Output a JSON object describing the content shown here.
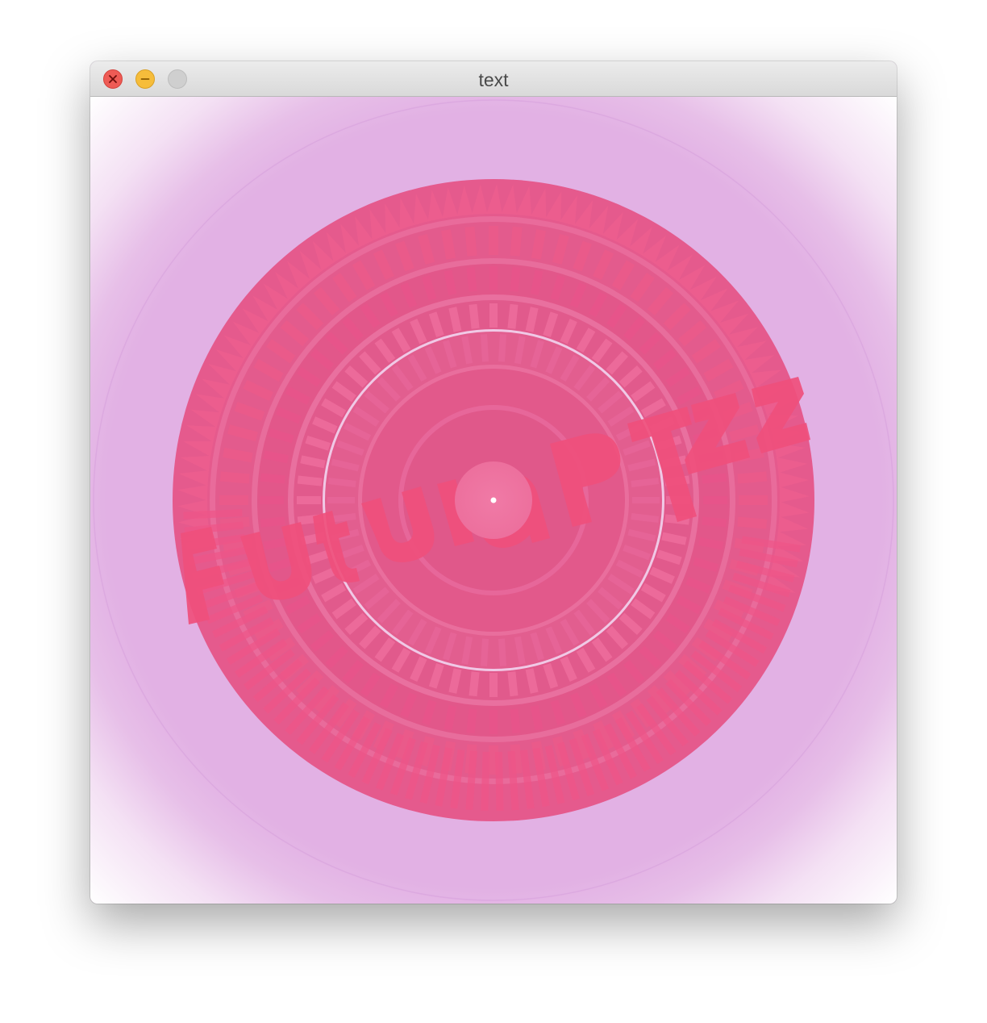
{
  "window": {
    "title": "text"
  },
  "titlebar": {
    "buttons": [
      {
        "name": "close",
        "icon": "close-icon",
        "color": "#ee5b55"
      },
      {
        "name": "minimize",
        "icon": "minimize-icon",
        "color": "#f6bd3b"
      },
      {
        "name": "zoom",
        "icon": "zoom-icon",
        "color": "#cfcfcf"
      }
    ]
  },
  "canvas": {
    "background_color": "#e2b1e4",
    "accent_color": "#ef4f7c",
    "ring_color": "#e7629a",
    "artwork_text": "Futura PT"
  }
}
